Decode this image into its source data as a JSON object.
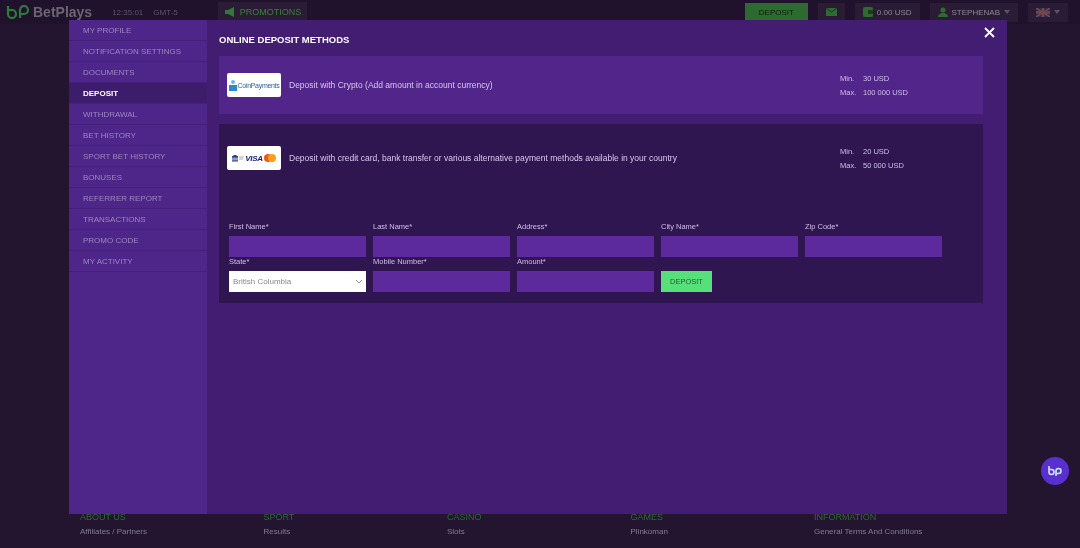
{
  "topbar": {
    "brand": "BetPlays",
    "clock": "12:35:01",
    "timezone": "GMT-5",
    "promotions": "PROMOTIONS",
    "deposit": "DEPOSIT",
    "balance": "0.00 USD",
    "username": "STEPHENAB"
  },
  "sidebar": {
    "items": [
      {
        "label": "MY PROFILE",
        "selected": false
      },
      {
        "label": "NOTIFICATION SETTINGS",
        "selected": false
      },
      {
        "label": "DOCUMENTS",
        "selected": false
      },
      {
        "label": "DEPOSIT",
        "selected": true
      },
      {
        "label": "WITHDRAWAL",
        "selected": false
      },
      {
        "label": "BET HISTORY",
        "selected": false
      },
      {
        "label": "SPORT BET HISTORY",
        "selected": false
      },
      {
        "label": "BONUSES",
        "selected": false
      },
      {
        "label": "REFERRER REPORT",
        "selected": false
      },
      {
        "label": "TRANSACTIONS",
        "selected": false
      },
      {
        "label": "PROMO CODE",
        "selected": false
      },
      {
        "label": "MY ACTIVITY",
        "selected": false
      }
    ]
  },
  "content": {
    "title": "ONLINE DEPOSIT METHODS",
    "methods": [
      {
        "kind": "crypto",
        "logo_text": "CoinPayments",
        "description": "Deposit with Crypto (Add amount in account currency)",
        "min_label": "Min.",
        "min": "30 USD",
        "max_label": "Max.",
        "max": "100 000 USD",
        "expanded": false
      },
      {
        "kind": "card",
        "logo_text": "VISA",
        "description": "Deposit with credit card, bank transfer or various alternative payment methods available in your country",
        "min_label": "Min.",
        "min": "20 USD",
        "max_label": "Max.",
        "max": "50 000 USD",
        "expanded": true
      }
    ]
  },
  "form": {
    "fields": [
      {
        "kind": "text",
        "label": "First Name*"
      },
      {
        "kind": "text",
        "label": "Last Name*"
      },
      {
        "kind": "text",
        "label": "Address*"
      },
      {
        "kind": "text",
        "label": "City Name*"
      },
      {
        "kind": "text",
        "label": "Zip Code*"
      },
      {
        "kind": "select",
        "label": "State*",
        "value": "British Columbia"
      },
      {
        "kind": "text",
        "label": "Mobile Number*"
      },
      {
        "kind": "text",
        "label": "Amount*"
      }
    ],
    "submit": "DEPOSIT"
  },
  "footer": {
    "columns": [
      {
        "title": "ABOUT US",
        "link": "Affiliates / Partners"
      },
      {
        "title": "SPORT",
        "link": "Results"
      },
      {
        "title": "CASINO",
        "link": "Slots"
      },
      {
        "title": "GAMES",
        "link": "Plinkoman"
      },
      {
        "title": "INFORMATION",
        "link": "General Terms And Conditions"
      }
    ]
  }
}
